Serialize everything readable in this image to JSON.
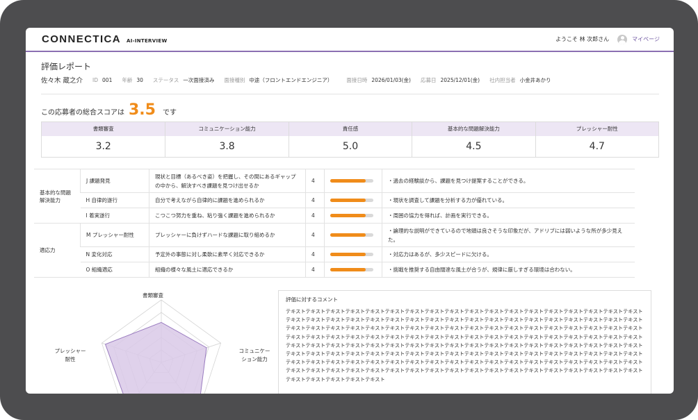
{
  "header": {
    "logo": "CONNECTICA",
    "logo_sub": "AI-INTERVIEW",
    "welcome": "ようこそ 林 次郎さん",
    "mypage": "マイページ"
  },
  "report": {
    "title": "評価レポート",
    "candidate_name": "佐々木 蔵之介",
    "info": [
      {
        "label": "ID",
        "value": "001"
      },
      {
        "label": "年齢",
        "value": "30"
      },
      {
        "label": "ステータス",
        "value": "一次面接済み"
      },
      {
        "label": "面接種別",
        "value": "中途（フロントエンドエンジニア）"
      },
      {
        "label": "面接日時",
        "value": "2026/01/03(金)"
      },
      {
        "label": "応募日",
        "value": "2025/12/01(金)"
      },
      {
        "label": "社内担当者",
        "value": "小金井あかり"
      }
    ],
    "total_prefix": "この応募者の総合スコアは",
    "total_score": "3.5",
    "total_suffix": "です"
  },
  "scores": [
    {
      "label": "書類審査",
      "value": "3.2"
    },
    {
      "label": "コミュニケーション能力",
      "value": "3.8"
    },
    {
      "label": "責任感",
      "value": "5.0"
    },
    {
      "label": "基本的な問題解決能力",
      "value": "4.5"
    },
    {
      "label": "プレッシャー耐性",
      "value": "4.7"
    }
  ],
  "detail": {
    "groups": [
      {
        "category": "基本的な問題解決能力",
        "rows": [
          {
            "code": "J 課題発見",
            "desc": "現状と目標（あるべき姿）を把握し、その間にあるギャップの中から、解決すべき課題を見つけ出せるか",
            "score": "4",
            "fill": 0.82,
            "comment": "・過去の経験談から、課題を見つけ提案することができる。"
          },
          {
            "code": "H 自律的遂行",
            "desc": "自分で考えながら自律的に課題を進められるか",
            "score": "4",
            "fill": 0.82,
            "comment": "・現状を調査して課題を分析する力が優れている。"
          },
          {
            "code": "I 着実遂行",
            "desc": "こつこつ努力を重ね、粘り強く課題を進められるか",
            "score": "4",
            "fill": 0.82,
            "comment": "・周囲の協力を得れば、計画を実行できる。"
          }
        ]
      },
      {
        "category": "適応力",
        "rows": [
          {
            "code": "M プレッシャー耐性",
            "desc": "プレッシャーに負けずハードな課題に取り組めるか",
            "score": "4",
            "fill": 0.82,
            "comment": "・論理的な説明ができているので地頭は良さそうな印象だが、アドリブには弱いような所が多少見えた。"
          },
          {
            "code": "N 変化対応",
            "desc": "予定外の事態に対し柔軟に素早く対応できるか",
            "score": "4",
            "fill": 0.82,
            "comment": "・対応力はあるが、多少スピードに欠ける。"
          },
          {
            "code": "O 組織適応",
            "desc": "組織の様々な風土に適応できるか",
            "score": "4",
            "fill": 0.82,
            "comment": "・挑戦を推奨する自由闊達な風土が合うが、規律に厳しすぎる環境は合わない。"
          }
        ]
      }
    ]
  },
  "radar": {
    "labels": [
      "書類審査",
      "コミュニケーション能力",
      "プレッシャー耐性"
    ],
    "max": 5,
    "values": [
      3.2,
      3.8,
      5.0,
      4.5,
      4.7
    ],
    "fill_color": "#d9c9e8",
    "stroke_color": "#9a7cc0"
  },
  "comment": {
    "title": "評価に対するコメント",
    "text": "テキストテキストテキストテキストテキストテキストテキストテキストテキストテキストテキストテキストテキストテキストテキストテキストテキストテキストテキストテキストテキストテキストテキストテキストテキストテキストテキストテキストテキストテキストテキストテキストテキストテキストテキストテキストテキストテキストテキストテキストテキストテキストテキストテキストテキストテキストテキストテキストテキストテキストテキストテキストテキストテキストテキストテキストテキストテキストテキストテキストテキストテキストテキストテキストテキストテキストテキストテキストテキストテキストテキストテキストテキストテキストテキストテキストテキストテキストテキストテキストテキストテキストテキストテキストテキストテキストテキストテキストテキストテキストテキストテキストテキストテキストテキストテキストテキストテキストテキストテキストテキストテキストテキストテキストテキストテキストテキストテキストテキストテキストテキストテキストテキストテキストテキストテキストテキストテキストテキストテキストテキストテキストテキストテキストテキストテキストテキストテキストテキストテキストテキストテキストテキストテキストテキストテキストテキストテキストテキストテキストテキストテキストテキストテキストテキストテキストテキストテキストテキスト"
  }
}
